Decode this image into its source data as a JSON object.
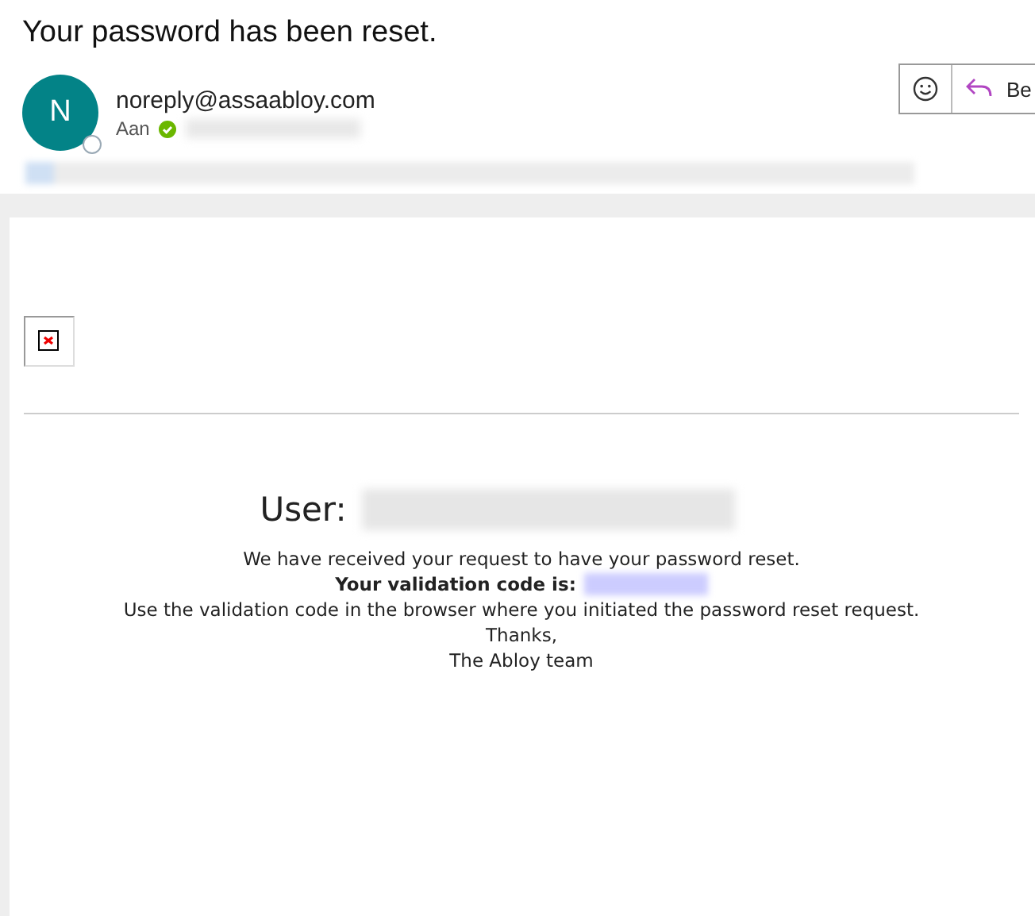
{
  "message": {
    "subject": "Your password has been reset.",
    "sender": {
      "initial": "N",
      "address": "noreply@assaabloy.com",
      "color": "#038387"
    },
    "recipient": {
      "label": "Aan",
      "verified": true
    },
    "actions": [
      {
        "kind": "emoji"
      },
      {
        "kind": "reply",
        "label": "Be"
      }
    ]
  },
  "body": {
    "user_label": "User:",
    "lines": [
      {
        "kind": "plain",
        "text": "We have received your request to have your password reset."
      },
      {
        "kind": "code",
        "text": "Your validation code is:"
      },
      {
        "kind": "plain",
        "text": "Use the validation code in the browser where you initiated the password reset request."
      },
      {
        "kind": "plain",
        "text": "Thanks,"
      },
      {
        "kind": "plain",
        "text": "The Abloy team"
      }
    ]
  }
}
